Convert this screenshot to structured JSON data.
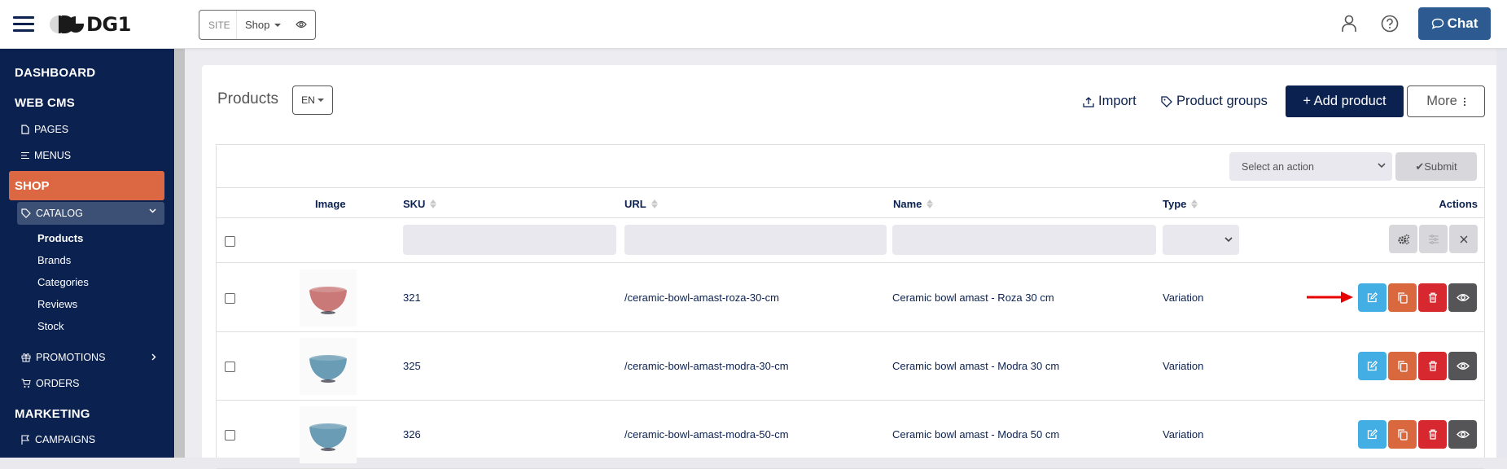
{
  "topbar": {
    "logo_text": "DG1",
    "site_label": "SITE",
    "site_value": "Shop",
    "chat_label": "Chat",
    "colors": {
      "chat_bg": "#2d5b91",
      "brand_navy": "#0b2150"
    }
  },
  "sidebar": {
    "sections": [
      {
        "label": "DASHBOARD"
      },
      {
        "label": "WEB CMS"
      }
    ],
    "items_webcms": [
      {
        "label": "PAGES",
        "icon": "file-icon"
      },
      {
        "label": "MENUS",
        "icon": "menu-lines-icon"
      }
    ],
    "shop_label": "SHOP",
    "catalog_label": "CATALOG",
    "catalog_children": [
      {
        "label": "Products",
        "active": true
      },
      {
        "label": "Brands"
      },
      {
        "label": "Categories"
      },
      {
        "label": "Reviews"
      },
      {
        "label": "Stock"
      }
    ],
    "promotions_label": "PROMOTIONS",
    "orders_label": "ORDERS",
    "marketing_label": "MARKETING",
    "campaigns_label": "CAMPAIGNS",
    "colors": {
      "active_section": "#db6842",
      "active_group": "#3c4f75"
    }
  },
  "main": {
    "title": "Products",
    "language": "EN",
    "import_label": "Import",
    "groups_label": "Product groups",
    "add_label": "+ Add product",
    "more_label": "More",
    "bulk": {
      "select_placeholder": "Select an action",
      "submit_label": "✔Submit"
    },
    "columns": [
      {
        "key": "image",
        "label": "Image",
        "sortable": false
      },
      {
        "key": "sku",
        "label": "SKU",
        "sortable": true
      },
      {
        "key": "url",
        "label": "URL",
        "sortable": true
      },
      {
        "key": "name",
        "label": "Name",
        "sortable": true
      },
      {
        "key": "type",
        "label": "Type",
        "sortable": true
      },
      {
        "key": "actions",
        "label": "Actions",
        "sortable": false
      }
    ],
    "rows": [
      {
        "sku": "321",
        "url": "/ceramic-bowl-amast-roza-30-cm",
        "name": "Ceramic bowl amast - Roza 30 cm",
        "type": "Variation",
        "bowl_color": "#c97a78"
      },
      {
        "sku": "325",
        "url": "/ceramic-bowl-amast-modra-30-cm",
        "name": "Ceramic bowl amast - Modra 30 cm",
        "type": "Variation",
        "bowl_color": "#6a9cb5"
      },
      {
        "sku": "326",
        "url": "/ceramic-bowl-amast-modra-50-cm",
        "name": "Ceramic bowl amast - Modra 50 cm",
        "type": "Variation",
        "bowl_color": "#6a9cb5"
      }
    ],
    "action_colors": {
      "edit": "#42aee4",
      "copy": "#d9683f",
      "delete": "#d7282f",
      "view": "#555557"
    }
  }
}
